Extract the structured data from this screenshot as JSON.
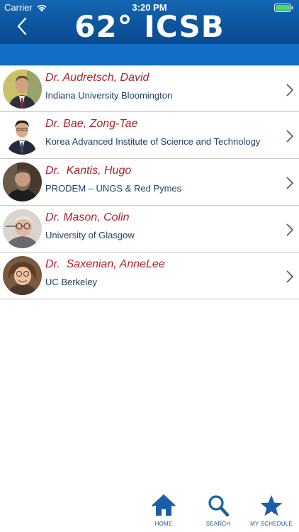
{
  "status_bar": {
    "carrier": "Carrier",
    "time": "3:20 PM"
  },
  "header": {
    "title": "62° ICSB"
  },
  "speakers": [
    {
      "name": "Dr. Audretsch, David",
      "affiliation": "Indiana University Bloomington"
    },
    {
      "name": "Dr. Bae, Zong-Tae",
      "affiliation": "Korea Advanced Institute of Science and Technology"
    },
    {
      "name": "Dr.  Kantis, Hugo",
      "affiliation": "PRODEM – UNGS & Red Pymes"
    },
    {
      "name": "Dr. Mason, Colin",
      "affiliation": "University of Glasgow"
    },
    {
      "name": "Dr.  Saxenian, AnneLee",
      "affiliation": "UC Berkeley"
    }
  ],
  "tabbar": {
    "home_label": "HOME",
    "search_label": "SEARCH",
    "schedule_label": "MY SCHEDULE"
  },
  "colors": {
    "header_blue": "#0d58a2",
    "subheader_blue": "#116ec5",
    "name_red": "#b2222a",
    "affiliation_navy": "#1f3f69",
    "tab_icon_blue": "#1a5ea8"
  }
}
